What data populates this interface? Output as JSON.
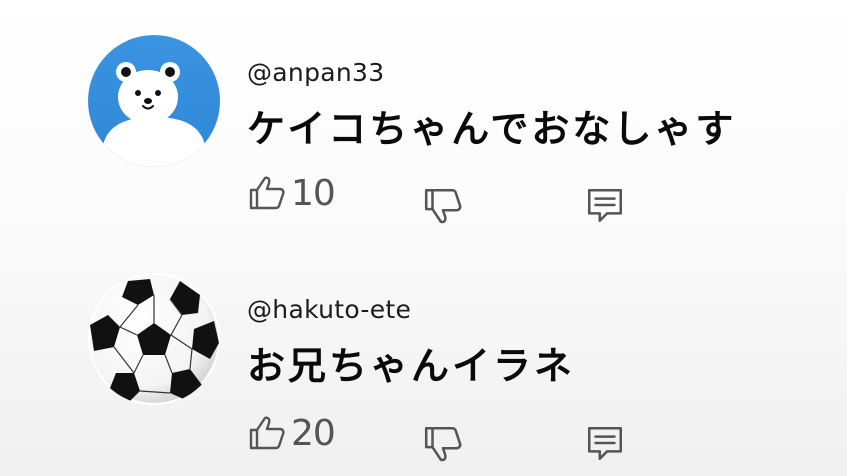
{
  "comments": [
    {
      "author": "@anpan33",
      "text": "ケイコちゃんでおなしゃす",
      "likes": "10",
      "avatar_icon": "bear-icon",
      "avatar_color": "#3b93e0"
    },
    {
      "author": "@hakuto-ete",
      "text": "お兄ちゃんイラネ",
      "likes": "20",
      "avatar_icon": "soccer-ball-icon",
      "avatar_color": "#ffffff"
    }
  ],
  "colors": {
    "icon": "#555555",
    "text": "#0a0a0a"
  }
}
